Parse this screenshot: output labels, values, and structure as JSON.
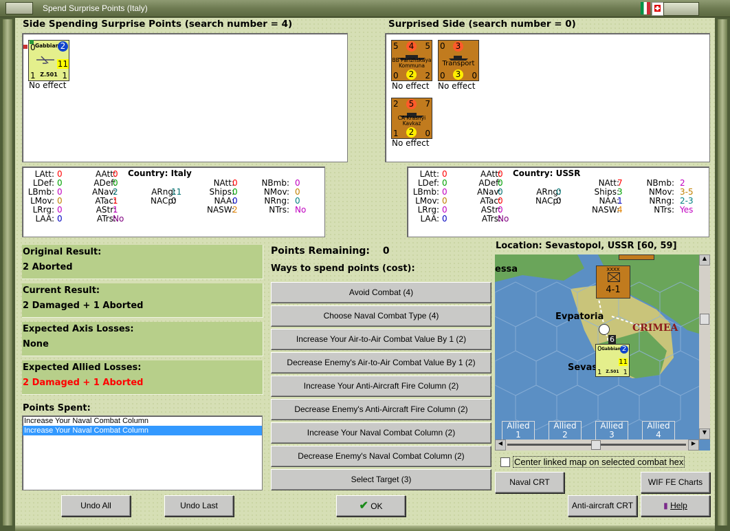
{
  "window": {
    "title": "Spend Surprise Points (Italy)"
  },
  "left_side": {
    "header": "Side Spending Surprise Points (search number = 4)",
    "units": [
      {
        "name": "Gabbiano",
        "code": "Z.501",
        "top_left": "0",
        "top_right": "2",
        "mid_right": "11",
        "bottom_left": "1",
        "bottom_right": "1",
        "effect": "No effect"
      }
    ]
  },
  "right_side": {
    "header": "Surprised Side (search number = 0)",
    "units": [
      {
        "name": "BB Parizhskaya Kommuna",
        "top_left": "5",
        "top_mid": "4",
        "top_right": "5",
        "bottom_left": "0",
        "bottom_mid": "2",
        "bottom_right": "2",
        "effect": "No effect"
      },
      {
        "name": "Transport",
        "top_left": "0",
        "top_mid": "3",
        "bottom_left": "0",
        "bottom_mid": "3",
        "bottom_right": "0",
        "effect": "No effect"
      },
      {
        "name": "CA Krasnyi Kavkaz",
        "top_left": "2",
        "top_mid": "5",
        "top_right": "7",
        "bottom_left": "1",
        "bottom_mid": "2",
        "bottom_right": "0",
        "effect": "No effect"
      }
    ]
  },
  "stats_left": {
    "country_label": "Country:",
    "country": "Italy",
    "LAtt": "0",
    "LDef": "0",
    "LBmb": "0",
    "LMov": "0",
    "LRrg": "0",
    "LAA": "0",
    "AAtt": "0",
    "ADef": "0",
    "ANav": "2",
    "ATac": "1",
    "AStr": "1",
    "ATrs": "No",
    "ARng": "11",
    "NACp": "0",
    "NAtt": "0",
    "Ships": "0",
    "NAA": "0",
    "NASW": "2",
    "NBmb": "0",
    "NMov": "0",
    "NRng": "0",
    "NTrs": "No"
  },
  "stats_right": {
    "country_label": "Country:",
    "country": "USSR",
    "LAtt": "0",
    "LDef": "0",
    "LBmb": "0",
    "LMov": "0",
    "LRrg": "0",
    "LAA": "0",
    "AAtt": "0",
    "ADef": "0",
    "ANav": "0",
    "ATac": "0",
    "AStr": "0",
    "ATrs": "No",
    "ARng": "0",
    "NACp": "0",
    "NAtt": "7",
    "Ships": "3",
    "NAA": "1",
    "NASW": "4",
    "NBmb": "2",
    "NMov": "3-5",
    "NRng": "2-3",
    "NTrs": "Yes"
  },
  "results": {
    "original_label": "Original Result:",
    "original_value": "2 Aborted",
    "current_label": "Current Result:",
    "current_value": "2 Damaged + 1 Aborted",
    "axis_label": "Expected Axis Losses:",
    "axis_value": "None",
    "allied_label": "Expected Allied Losses:",
    "allied_value": "2 Damaged + 1 Aborted"
  },
  "points_spent": {
    "label": "Points Spent:",
    "items": [
      "Increase Your Naval Combat Column",
      "Increase Your Naval Combat Column"
    ]
  },
  "spend": {
    "remaining_label": "Points Remaining:",
    "remaining_value": "0",
    "ways_label": "Ways to spend points (cost):",
    "options": [
      "Avoid Combat (4)",
      "Choose Naval Combat Type (4)",
      "Increase Your Air-to-Air Combat Value By 1 (2)",
      "Decrease Enemy's Air-to-Air Combat Value By 1 (2)",
      "Increase Your Anti-Aircraft Fire Column (2)",
      "Decrease Enemy's Anti-Aircraft Fire Column (2)",
      "Increase Your Naval Combat Column (2)",
      "Decrease Enemy's Naval Combat Column (2)",
      "Select Target (3)"
    ]
  },
  "map": {
    "location": "Location: Sevastopol, USSR [60, 59]",
    "labels": {
      "essa": "essa",
      "evpatoria": "Evpatoria",
      "crimea": "CRIMEA",
      "sevas": "Sevas"
    },
    "unit_strength": "4-1",
    "unit_top": "XXXX",
    "counter_number": "6",
    "air_unit": {
      "name": "Gabbiano",
      "code": "Z.501",
      "top_left": "0",
      "top_right": "2",
      "mid_right": "11",
      "bottom_left": "1",
      "bottom_right": "1"
    },
    "allied_tabs": [
      {
        "label": "Allied",
        "num": "1"
      },
      {
        "label": "Allied",
        "num": "2"
      },
      {
        "label": "Allied",
        "num": "3"
      },
      {
        "label": "Allied",
        "num": "4"
      }
    ],
    "center_checkbox_label": "Center linked map on selected combat hex",
    "center_checked": false
  },
  "buttons": {
    "undo_all": "Undo All",
    "undo_last": "Undo Last",
    "ok": "OK",
    "naval_crt": "Naval CRT",
    "wif_charts": "WIF FE Charts",
    "aa_crt": "Anti-aircraft CRT",
    "help": "Help"
  },
  "colors": {
    "panel_green": "#b7cf8a",
    "red_text": "#ff0000",
    "naval_counter": "#c17b1e",
    "air_counter": "#e4ef8c"
  }
}
